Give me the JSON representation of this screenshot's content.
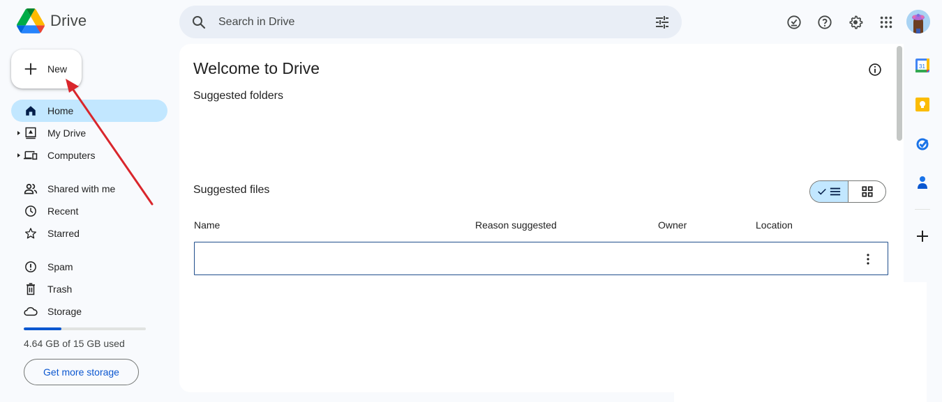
{
  "app": {
    "name": "Drive"
  },
  "search": {
    "placeholder": "Search in Drive",
    "value": ""
  },
  "top_icons": [
    {
      "name": "ready-for-offline-icon",
      "label": "Ready for offline"
    },
    {
      "name": "help-icon",
      "label": "Support"
    },
    {
      "name": "settings-icon",
      "label": "Settings"
    },
    {
      "name": "apps-grid-icon",
      "label": "Google apps"
    }
  ],
  "new_button": {
    "label": "New"
  },
  "sidebar": {
    "items": [
      {
        "label": "Home",
        "icon": "home-icon",
        "active": true,
        "expandable": false
      },
      {
        "label": "My Drive",
        "icon": "my-drive-icon",
        "active": false,
        "expandable": true
      },
      {
        "label": "Computers",
        "icon": "computers-icon",
        "active": false,
        "expandable": true
      },
      {
        "label": "Shared with me",
        "icon": "shared-icon",
        "active": false,
        "expandable": false
      },
      {
        "label": "Recent",
        "icon": "clock-icon",
        "active": false,
        "expandable": false
      },
      {
        "label": "Starred",
        "icon": "star-icon",
        "active": false,
        "expandable": false
      },
      {
        "label": "Spam",
        "icon": "spam-icon",
        "active": false,
        "expandable": false
      },
      {
        "label": "Trash",
        "icon": "trash-icon",
        "active": false,
        "expandable": false
      },
      {
        "label": "Storage",
        "icon": "cloud-icon",
        "active": false,
        "expandable": false
      }
    ],
    "storage": {
      "used_text": "4.64 GB of 15 GB used",
      "used_fraction": 0.309,
      "button_label": "Get more storage"
    }
  },
  "main": {
    "title": "Welcome to Drive",
    "suggested_folders_title": "Suggested folders",
    "suggested_files_title": "Suggested files",
    "view_mode": "list",
    "columns": [
      "Name",
      "Reason suggested",
      "Owner",
      "Location"
    ],
    "rows": [
      {
        "name": "",
        "reason": "",
        "owner": "",
        "location": ""
      }
    ]
  },
  "side_apps": [
    {
      "name": "calendar-app",
      "label": "Calendar",
      "badge": "31"
    },
    {
      "name": "keep-app",
      "label": "Keep"
    },
    {
      "name": "tasks-app",
      "label": "Tasks"
    },
    {
      "name": "contacts-app",
      "label": "Contacts"
    }
  ],
  "colors": {
    "accent": "#0b57d0",
    "active_nav": "#c2e7ff",
    "annotation_arrow": "#d9262c"
  }
}
